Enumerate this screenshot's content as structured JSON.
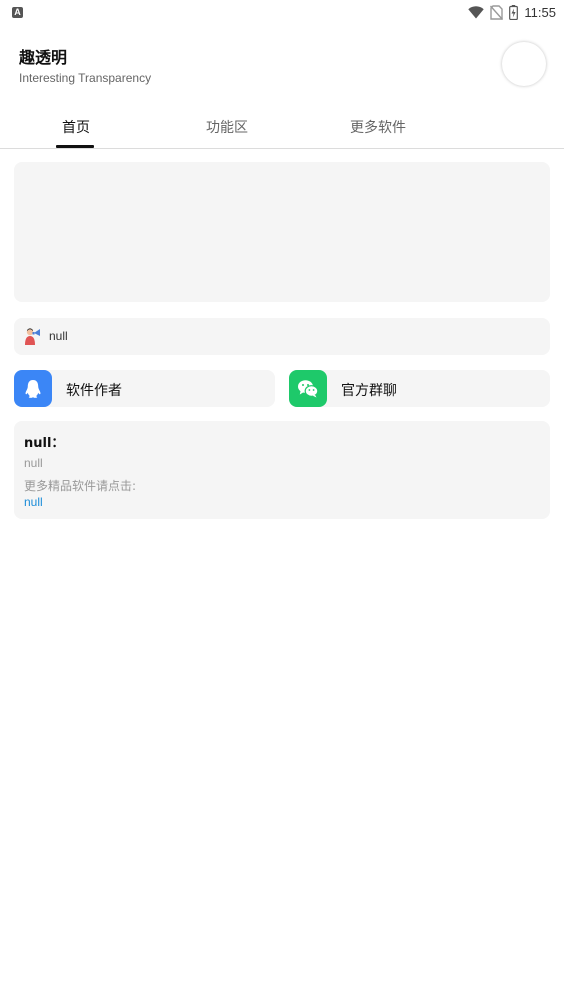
{
  "status_bar": {
    "time": "11:55",
    "app_icon_letter": "A",
    "icons": [
      "wifi-icon",
      "no-sim-icon",
      "battery-charging-icon"
    ]
  },
  "header": {
    "title": "趣透明",
    "subtitle": "Interesting Transparency"
  },
  "tabs": [
    {
      "label": "首页",
      "active": true
    },
    {
      "label": "功能区",
      "active": false
    },
    {
      "label": "更多软件",
      "active": false
    }
  ],
  "notice": {
    "icon": "megaphone-person-icon",
    "text": "null"
  },
  "actions": {
    "author_label": "软件作者",
    "author_icon": "qq-penguin-icon",
    "group_label": "官方群聊",
    "group_icon": "wechat-icon"
  },
  "info": {
    "title": "null：",
    "body": "null",
    "more_label": "更多精品软件请点击:",
    "link": "null"
  },
  "colors": {
    "qq_blue": "#3b86f6",
    "wechat_green": "#1ec96a",
    "link_blue": "#1a8cd8",
    "card_bg": "#f5f5f5"
  }
}
